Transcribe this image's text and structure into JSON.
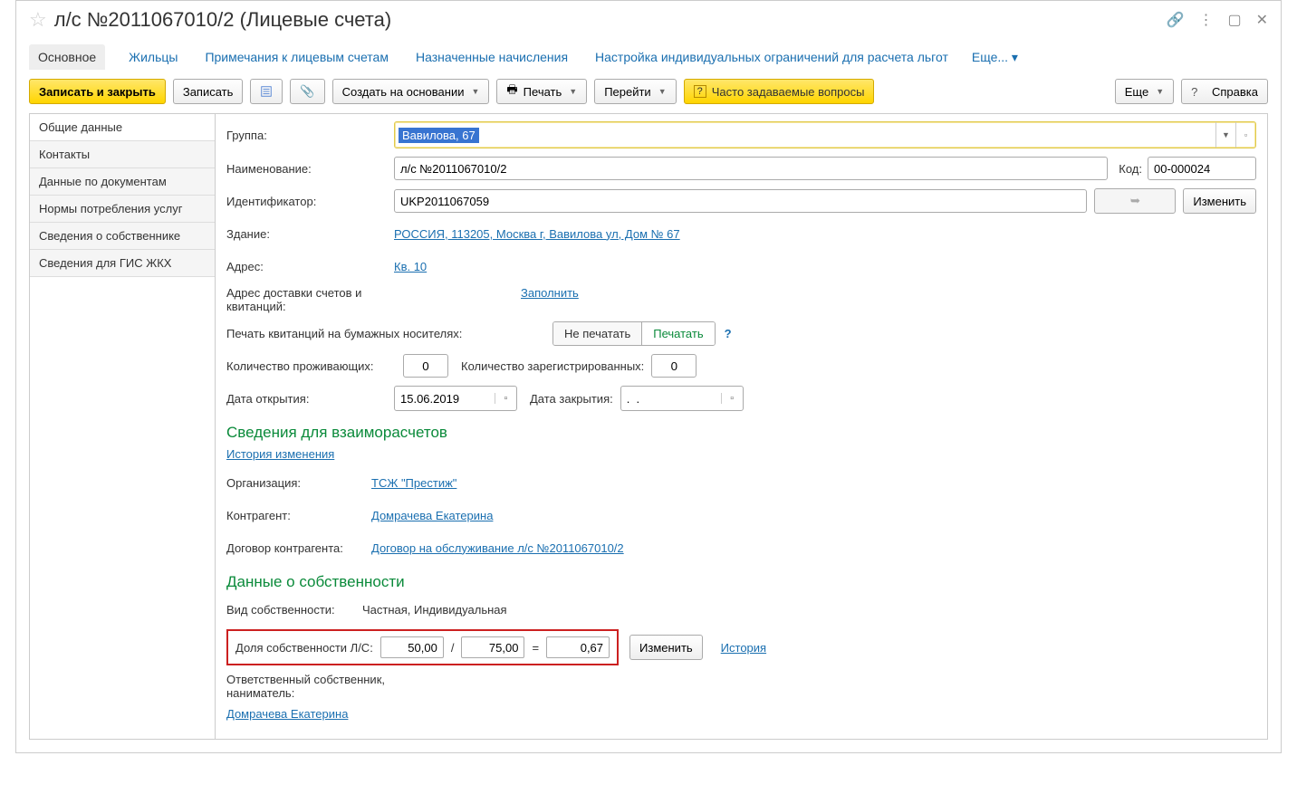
{
  "title": "л/с №2011067010/2 (Лицевые счета)",
  "nav": {
    "main": "Основное",
    "tenants": "Жильцы",
    "notes": "Примечания к лицевым счетам",
    "charges": "Назначенные начисления",
    "limits": "Настройка индивидуальных ограничений для расчета льгот",
    "more": "Еще..."
  },
  "toolbar": {
    "save_close": "Записать и закрыть",
    "save": "Записать",
    "create_based": "Создать на основании",
    "print": "Печать",
    "goto": "Перейти",
    "faq": "Часто задаваемые вопросы",
    "more": "Еще",
    "help": "Справка"
  },
  "sidebar": {
    "items": [
      "Общие данные",
      "Контакты",
      "Данные по документам",
      "Нормы потребления услуг",
      "Сведения о собственнике",
      "Сведения для ГИС ЖКХ"
    ]
  },
  "form": {
    "group_lbl": "Группа:",
    "group_val": "Вавилова, 67",
    "name_lbl": "Наименование:",
    "name_val": "л/с №2011067010/2",
    "code_lbl": "Код:",
    "code_val": "00-000024",
    "ident_lbl": "Идентификатор:",
    "ident_val": "UKP2011067059",
    "ident_btn": "Изменить",
    "building_lbl": "Здание:",
    "building_val": "РОССИЯ, 113205, Москва г, Вавилова ул, Дом № 67",
    "addr_lbl": "Адрес:",
    "addr_val": "Кв. 10",
    "delivery_lbl": "Адрес доставки счетов и квитанций:",
    "delivery_link": "Заполнить",
    "print_media_lbl": "Печать квитанций на бумажных носителях:",
    "print_off": "Не печатать",
    "print_on": "Печатать",
    "residents_lbl": "Количество проживающих:",
    "residents_val": "0",
    "registered_lbl": "Количество зарегистрированных:",
    "registered_val": "0",
    "open_lbl": "Дата открытия:",
    "open_val": "15.06.2019",
    "close_lbl": "Дата закрытия:",
    "close_val": ".  .",
    "sec_settlements": "Сведения для взаиморасчетов",
    "history_link": "История изменения",
    "org_lbl": "Организация:",
    "org_val": "ТСЖ \"Престиж\"",
    "counterparty_lbl": "Контрагент:",
    "counterparty_val": "Домрачева Екатерина",
    "contract_lbl": "Договор контрагента:",
    "contract_val": "Договор на обслуживание л/с №2011067010/2",
    "sec_ownership": "Данные о собственности",
    "own_type_lbl": "Вид собственности:",
    "own_type_val": "Частная, Индивидуальная",
    "share_lbl": "Доля собственности Л/С:",
    "share_num": "50,00",
    "share_den": "75,00",
    "share_res": "0,67",
    "share_btn": "Изменить",
    "share_history": "История",
    "resp_lbl": "Ответственный собственник, наниматель:",
    "resp_val": "Домрачева Екатерина"
  }
}
